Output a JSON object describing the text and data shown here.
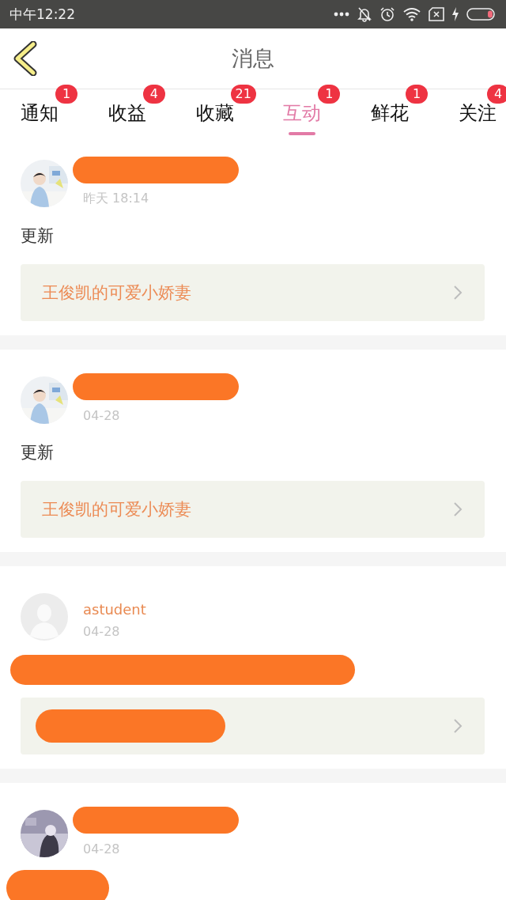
{
  "status_bar": {
    "time": "中午12:22"
  },
  "header": {
    "title": "消息"
  },
  "tabs": [
    {
      "label": "通知",
      "badge": "1",
      "selected": false
    },
    {
      "label": "收益",
      "badge": "4",
      "selected": false
    },
    {
      "label": "收藏",
      "badge": "21",
      "selected": false
    },
    {
      "label": "互动",
      "badge": "1",
      "selected": true
    },
    {
      "label": "鲜花",
      "badge": "1",
      "selected": false
    },
    {
      "label": "关注",
      "badge": "4",
      "selected": false
    }
  ],
  "messages": [
    {
      "name_redacted": true,
      "time": "昨天 18:14",
      "body": "更新",
      "body_redacted": false,
      "link": {
        "text": "王俊凯的可爱小娇妻",
        "redacted": false
      }
    },
    {
      "name_redacted": true,
      "time": "04-28",
      "body": "更新",
      "body_redacted": false,
      "link": {
        "text": "王俊凯的可爱小娇妻",
        "redacted": false
      }
    },
    {
      "avatar": {
        "kind": "default"
      },
      "name": "astudent",
      "name_redacted": false,
      "time": "04-28",
      "body_redacted": true,
      "link": {
        "redacted": true
      }
    },
    {
      "name_redacted": true,
      "time": "04-28",
      "body_redacted": true
    }
  ]
}
